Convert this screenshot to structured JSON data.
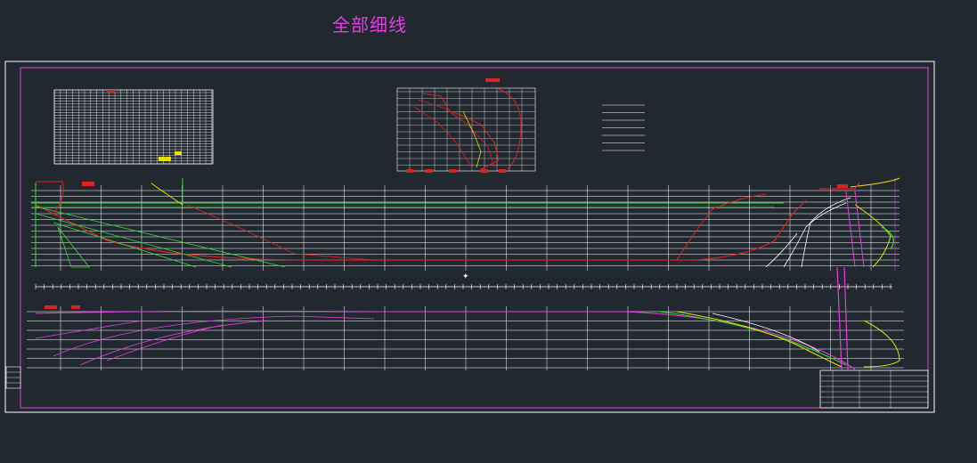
{
  "drawing": {
    "title": "全部细线"
  },
  "colors": {
    "background": "#212830",
    "frame": "#ffffff",
    "inner_frame": "#e040e0",
    "grid": "#ffffff",
    "waterline": "#33dd33",
    "profile": "#dd2222",
    "bow_lines": "#e8e000",
    "half_breadth": "#e040e0",
    "title_text": "#e040e0"
  }
}
